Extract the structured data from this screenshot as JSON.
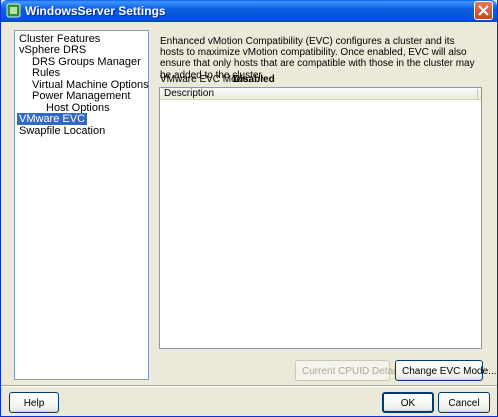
{
  "window": {
    "title": "WindowsServer Settings"
  },
  "tree": {
    "items": [
      {
        "label": "Cluster Features",
        "indent": 0,
        "selected": false
      },
      {
        "label": "vSphere DRS",
        "indent": 0,
        "selected": false
      },
      {
        "label": "DRS Groups Manager",
        "indent": 1,
        "selected": false
      },
      {
        "label": "Rules",
        "indent": 1,
        "selected": false
      },
      {
        "label": "Virtual Machine Options",
        "indent": 1,
        "selected": false
      },
      {
        "label": "Power Management",
        "indent": 1,
        "selected": false
      },
      {
        "label": "Host Options",
        "indent": 2,
        "selected": false
      },
      {
        "label": "VMware EVC",
        "indent": 0,
        "selected": true
      },
      {
        "label": "Swapfile Location",
        "indent": 0,
        "selected": false
      }
    ]
  },
  "main": {
    "description": "Enhanced vMotion Compatibility (EVC) configures a cluster and its hosts to maximize vMotion compatibility. Once enabled, EVC will also ensure that only hosts that are compatible with those in the cluster may be added to the cluster.",
    "evc_mode_label": "VMware EVC Mode:",
    "evc_mode_value": "Disabled",
    "table": {
      "columns": [
        "Description"
      ],
      "rows": []
    },
    "buttons": {
      "cpuid": "Current CPUID Details...",
      "change": "Change EVC Mode..."
    }
  },
  "footer": {
    "help": "Help",
    "ok": "OK",
    "cancel": "Cancel"
  }
}
